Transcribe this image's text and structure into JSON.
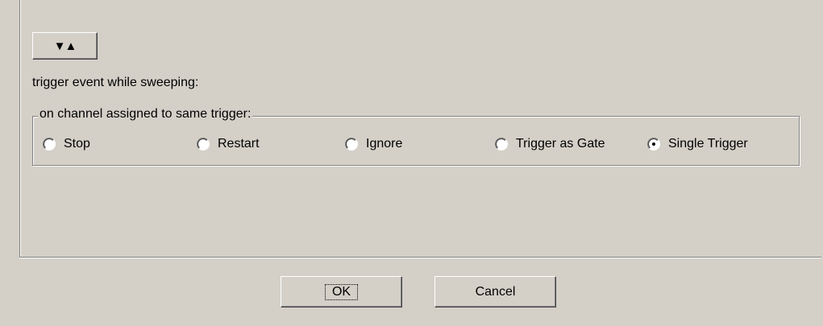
{
  "toggle_button": {
    "label": "▼▲",
    "icon": "sort-toggle-icon"
  },
  "trigger_label": "trigger event while sweeping:",
  "channel_group": {
    "title": "on channel assigned to same trigger:",
    "options": [
      {
        "label": "Stop",
        "selected": false
      },
      {
        "label": "Restart",
        "selected": false
      },
      {
        "label": "Ignore",
        "selected": false
      },
      {
        "label": "Trigger as Gate",
        "selected": false
      },
      {
        "label": "Single Trigger",
        "selected": true
      }
    ]
  },
  "dialog_buttons": {
    "ok": "OK",
    "cancel": "Cancel"
  }
}
